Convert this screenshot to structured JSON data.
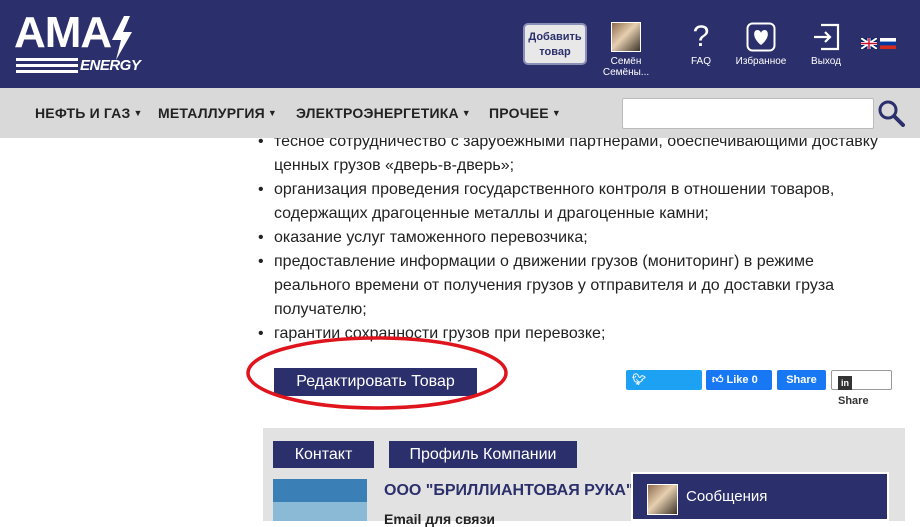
{
  "header": {
    "logo_text": "AMA",
    "logo_sub": "ENERGY",
    "add_product": "Добавить товар",
    "user_name": "Семён Семёны...",
    "faq": "FAQ",
    "favorites": "Избранное",
    "logout": "Выход",
    "flags": [
      "en-flag",
      "ru-flag"
    ],
    "brand_color": "#2b2f6b"
  },
  "nav": {
    "items": [
      {
        "label": "НЕФТЬ И ГАЗ"
      },
      {
        "label": "МЕТАЛЛУРГИЯ"
      },
      {
        "label": "ЭЛЕКТРОЭНЕРГЕТИКА"
      },
      {
        "label": "ПРОЧЕЕ"
      }
    ],
    "search_value": "",
    "search_placeholder": ""
  },
  "content": {
    "lines": [
      "тесное сотрудничество с зарубежными партнерами, обеспечивающими доставку",
      "ценных грузов «дверь-в-дверь»;",
      "организация проведения государственного контроля в отношении товаров,",
      "содержащих драгоценные металлы и драгоценные камни;",
      "оказание услуг таможенного перевозчика;",
      "предоставление информации о движении грузов (мониторинг) в режиме",
      "реального времени от получения грузов у отправителя и до доставки груза",
      "получателю;",
      "гарантии сохранности грузов при перевозке;"
    ]
  },
  "actions": {
    "edit_product": "Редактировать Товар",
    "tweet": "Твитнуть",
    "like": "Like 0",
    "fb_share": "Share",
    "in_share": "Share"
  },
  "company": {
    "tab_contact": "Контакт",
    "tab_profile": "Профиль Компании",
    "name": "ООО \"БРИЛЛИАНТОВАЯ РУКА\"",
    "email_label": "Email для связи"
  },
  "messages": {
    "label": "Сообщения"
  }
}
